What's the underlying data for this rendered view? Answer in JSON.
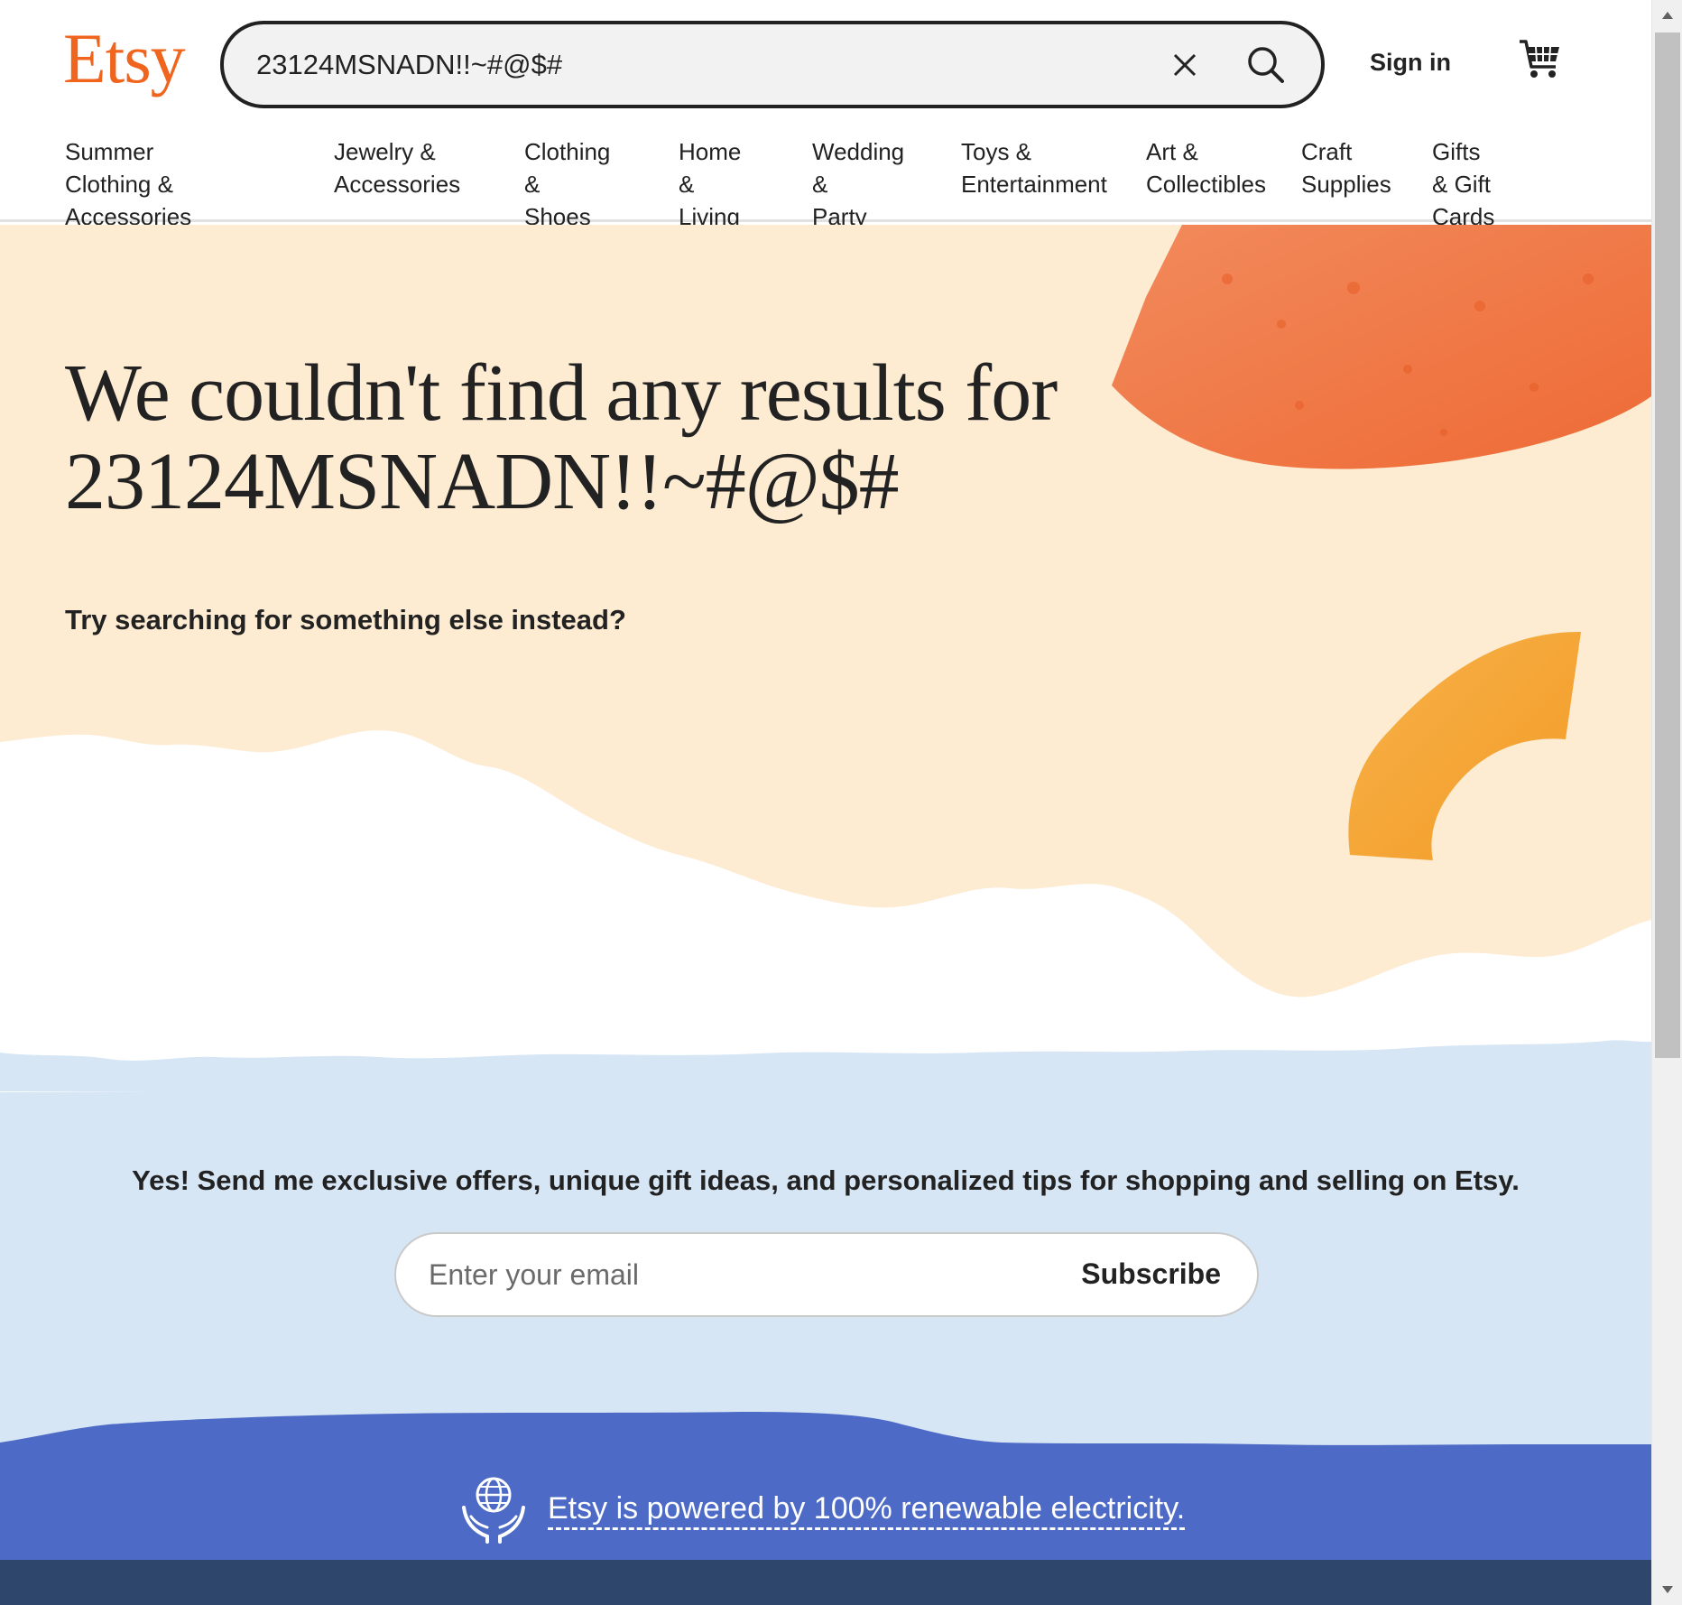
{
  "header": {
    "logo": "Etsy",
    "search_value": "23124MSNADN!!~#@$#",
    "sign_in": "Sign in"
  },
  "nav": [
    {
      "line1": "Summer Clothing &",
      "line2": "Accessories"
    },
    {
      "line1": "Jewelry &",
      "line2": "Accessories"
    },
    {
      "line1": "Clothing &",
      "line2": "Shoes"
    },
    {
      "line1": "Home &",
      "line2": "Living"
    },
    {
      "line1": "Wedding &",
      "line2": "Party"
    },
    {
      "line1": "Toys &",
      "line2": "Entertainment"
    },
    {
      "line1": "Art &",
      "line2": "Collectibles"
    },
    {
      "line1": "Craft",
      "line2": "Supplies"
    },
    {
      "line1": "Gifts & Gift",
      "line2": "Cards"
    }
  ],
  "hero": {
    "headline_line1": "We couldn't find any results for",
    "headline_line2": "23124MSNADN!!~#@$#",
    "suggestion": "Try searching for something else instead?"
  },
  "newsletter": {
    "text": "Yes! Send me exclusive offers, unique gift ideas, and personalized tips for shopping and selling on Etsy.",
    "email_placeholder": "Enter your email",
    "subscribe_label": "Subscribe"
  },
  "renewable": {
    "link_text": "Etsy is powered by 100% renewable electricity."
  },
  "icons": {
    "clear": "close-icon",
    "search": "search-icon",
    "cart": "cart-icon",
    "globe": "globe-hands-icon"
  },
  "colors": {
    "brand": "#F1641E",
    "hero_bg": "#FDEBD2",
    "newsletter_bg": "#D7E6F5",
    "renew_bg": "#4D6BC6",
    "footer_bg": "#2F466C"
  }
}
